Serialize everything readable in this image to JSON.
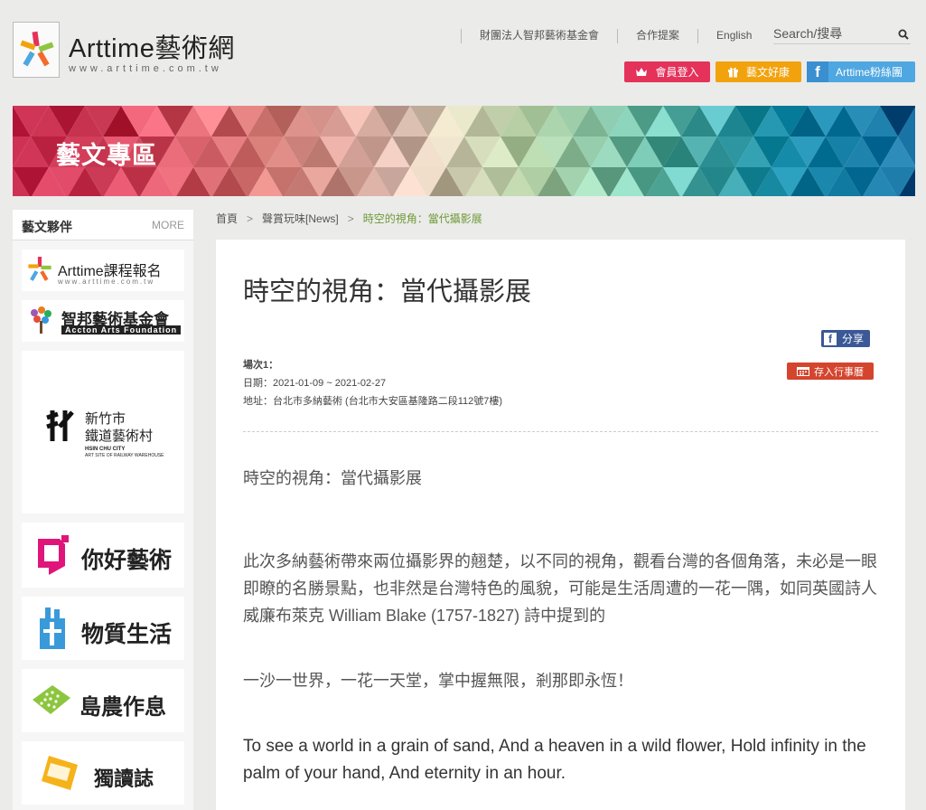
{
  "header": {
    "logo_text": "Arttime藝術網",
    "logo_url": "www.arttime.com.tw",
    "links": [
      "財團法人智邦藝術基金會",
      "合作提案",
      "English"
    ],
    "search_placeholder": "Search/搜尋",
    "buttons": {
      "login": "會員登入",
      "gift": "藝文好康",
      "fans": "Arttime粉絲團"
    }
  },
  "banner": {
    "title": "藝文專區"
  },
  "sidebar": {
    "title": "藝文夥伴",
    "more": "MORE",
    "partners": [
      {
        "name": "Arttime課程報名",
        "sub": "www.arttime.com.tw"
      },
      {
        "name": "智邦藝術基金會",
        "sub": "Accton Arts Foundation"
      },
      {
        "name": "新竹市\n鐵道藝術村",
        "sub": "HSIN CHU CITY",
        "sub2": "ART SITE OF RAILWAY WAREHOUSE"
      },
      {
        "name": "你好藝術"
      },
      {
        "name": "物質生活"
      },
      {
        "name": "島農作息"
      },
      {
        "name": "獨讀誌"
      }
    ]
  },
  "breadcrumb": {
    "home": "首頁",
    "section": "聲賞玩味[News]",
    "current": "時空的視角：當代攝影展"
  },
  "article": {
    "title": "時空的視角：當代攝影展",
    "share_label": "分享",
    "calendar_label": "存入行事曆",
    "session": "場次1：",
    "date": "日期：2021-01-09 ~ 2021-02-27",
    "address": "地址：台北市多納藝術 (台北市大安區基隆路二段112號7樓)",
    "paragraphs": [
      "時空的視角：當代攝影展",
      "此次多納藝術帶來兩位攝影界的翹楚，以不同的視角，觀看台灣的各個角落，未必是一眼即瞭的名勝景點，也非然是台灣特色的風貌，可能是生活周遭的一花一隅，如同英國詩人威廉布萊克 William Blake (1757-1827) 詩中提到的",
      "一沙一世界，一花一天堂，掌中握無限，剎那即永恆！",
      "To see a world in a grain of sand, And a heaven in a wild flower, Hold infinity in the palm of your hand, And eternity in an hour."
    ]
  },
  "colors": {
    "login": "#e4325a",
    "gift": "#f2a20c",
    "fans": "#4ea7e0",
    "breadcrumb_current": "#6f9a37",
    "facebook": "#3b5897",
    "calendar": "#d4452d"
  }
}
